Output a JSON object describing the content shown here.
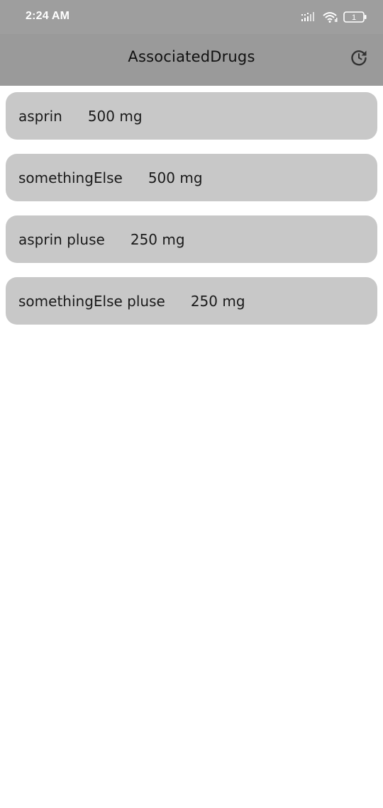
{
  "status_bar": {
    "time": "2:24 AM",
    "battery_level": "1",
    "icons": [
      "signal-icon",
      "wifi-icon",
      "battery-icon"
    ]
  },
  "app_bar": {
    "title": "AssociatedDrugs",
    "refresh_icon": "refresh-icon"
  },
  "drugs": [
    {
      "name": "asprin",
      "dose": "500 mg"
    },
    {
      "name": "somethingElse",
      "dose": "500 mg"
    },
    {
      "name": "asprin pluse",
      "dose": "250 mg"
    },
    {
      "name": "somethingElse pluse",
      "dose": "250 mg"
    }
  ],
  "colors": {
    "status_bar_bg": "#9e9e9e",
    "app_bar_bg": "#9a9a9a",
    "list_item_bg": "#c8c8c8",
    "text": "#1a1a1a"
  }
}
